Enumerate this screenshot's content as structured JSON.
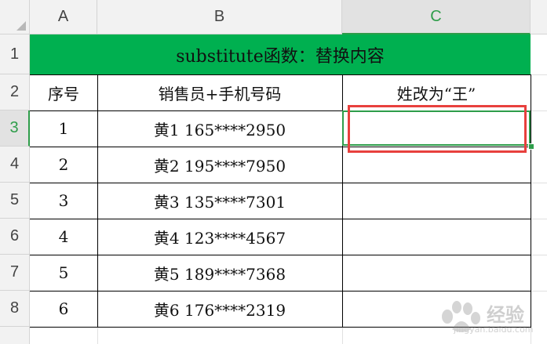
{
  "columns": [
    "A",
    "B",
    "C"
  ],
  "rows": [
    "1",
    "2",
    "3",
    "4",
    "5",
    "6",
    "7",
    "8"
  ],
  "title": "substitute函数：替换内容",
  "headers": {
    "seq": "序号",
    "sales_phone": "销售员+手机号码",
    "replace": "姓改为“王”"
  },
  "data": [
    {
      "seq": "1",
      "value": "黄1 165****2950",
      "result": ""
    },
    {
      "seq": "2",
      "value": "黄2 195****7950",
      "result": ""
    },
    {
      "seq": "3",
      "value": "黄3 135****7301",
      "result": ""
    },
    {
      "seq": "4",
      "value": "黄4 123****4567",
      "result": ""
    },
    {
      "seq": "5",
      "value": "黄5 189****7368",
      "result": ""
    },
    {
      "seq": "6",
      "value": "黄6 176****2319",
      "result": ""
    }
  ],
  "colors": {
    "title_fill": "#00b050",
    "selection": "#2e9d4a",
    "highlight_box": "#e8403d"
  },
  "watermark": {
    "icon": "baidu-paw-icon",
    "text": "经验",
    "url_text": "jingyan.baidu.com"
  }
}
